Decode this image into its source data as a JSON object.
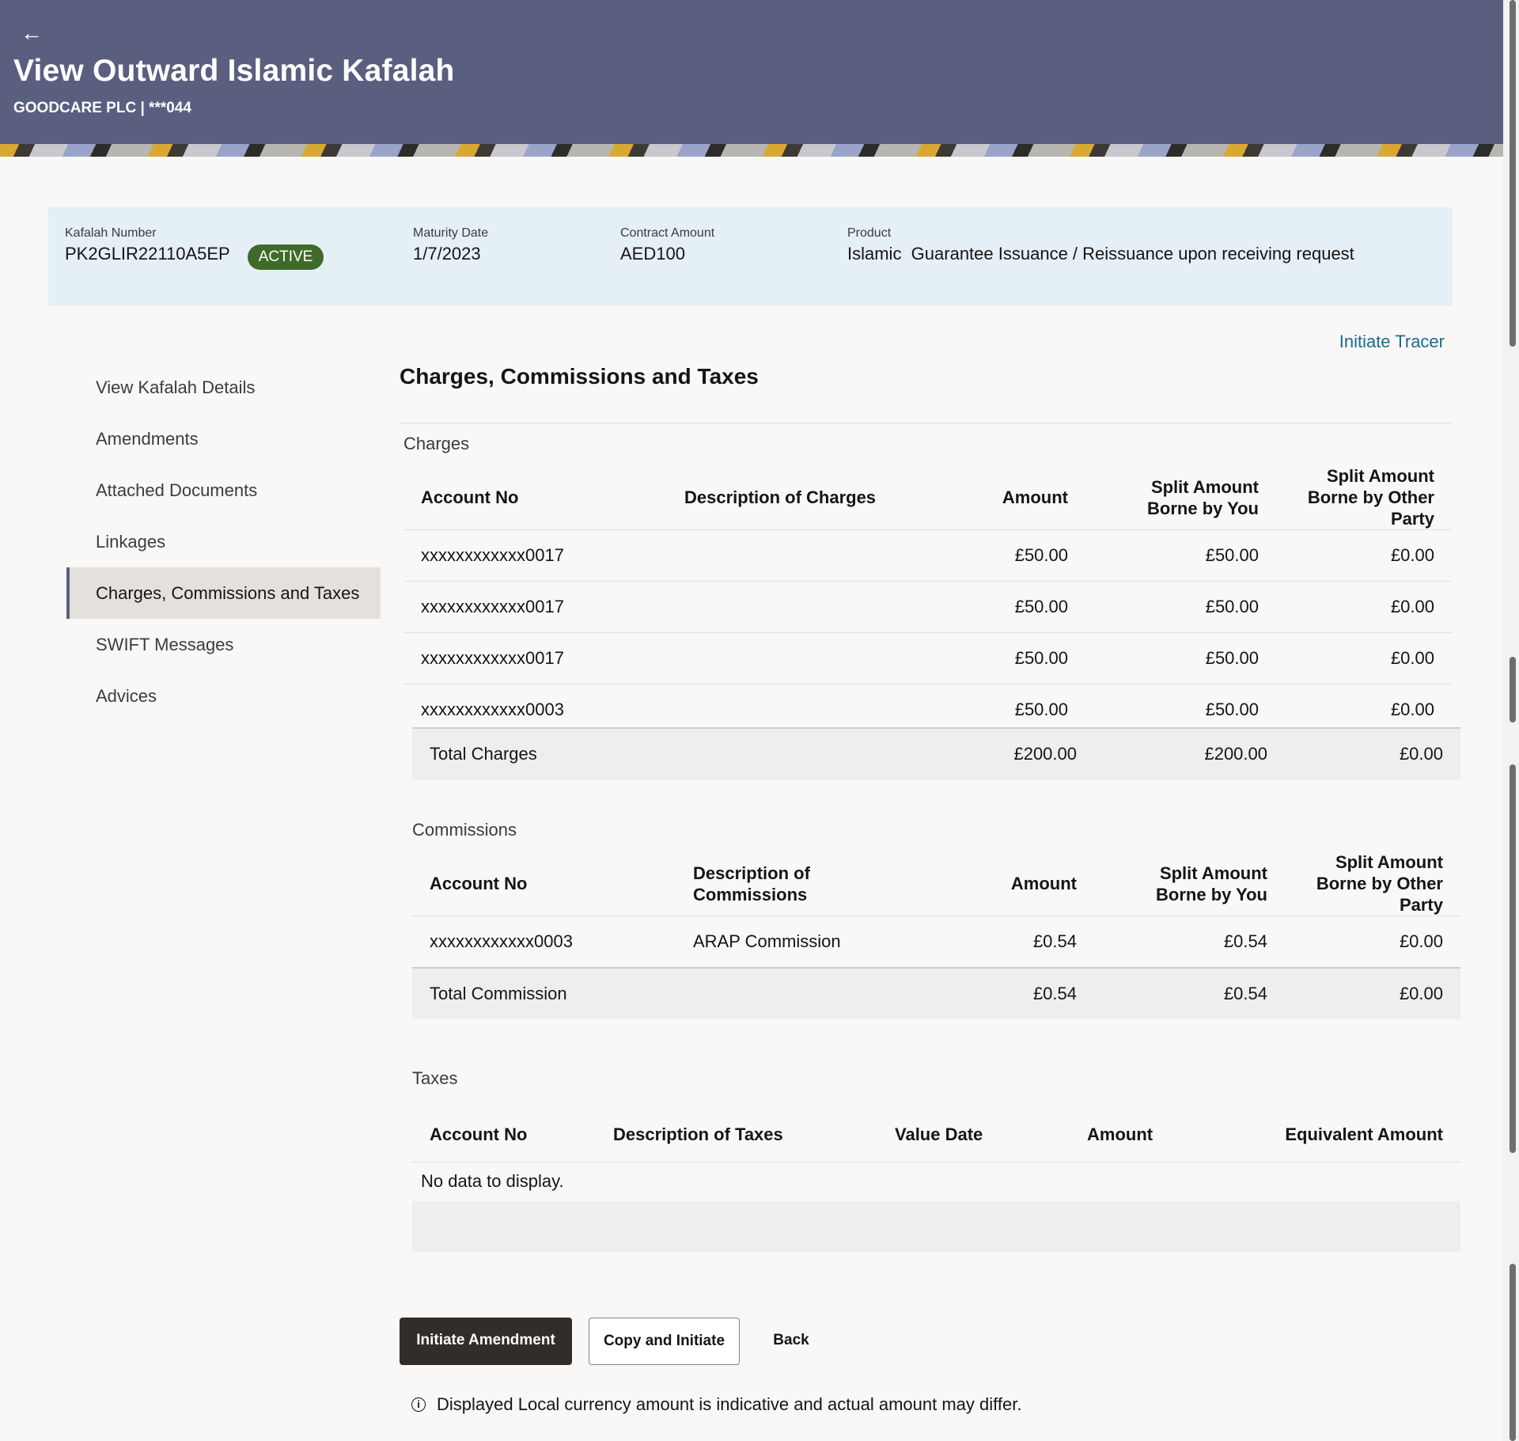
{
  "header": {
    "back_label": "←",
    "title": "View Outward Islamic Kafalah",
    "subtitle": "GOODCARE PLC | ***044"
  },
  "summary": {
    "kafalah_number_label": "Kafalah Number",
    "kafalah_number": "PK2GLIR22110A5EP",
    "status": "ACTIVE",
    "maturity_label": "Maturity Date",
    "maturity_date": "1/7/2023",
    "contract_amount_label": "Contract Amount",
    "contract_amount": "AED100",
    "product_label": "Product",
    "product": "Islamic  Guarantee Issuance / Reissuance upon receiving request",
    "status_color": "#3f6b2a"
  },
  "initiate_tracer": "Initiate Tracer",
  "nav": {
    "items": [
      {
        "label": "View Kafalah Details"
      },
      {
        "label": "Amendments"
      },
      {
        "label": "Attached Documents"
      },
      {
        "label": "Linkages"
      },
      {
        "label": "Charges, Commissions and Taxes"
      },
      {
        "label": "SWIFT Messages"
      },
      {
        "label": "Advices"
      }
    ]
  },
  "section_title": "Charges, Commissions and Taxes",
  "charges": {
    "label": "Charges",
    "headers": [
      "Account No",
      "Description of Charges",
      "Amount",
      "Split Amount Borne by You",
      "Split Amount Borne by Other Party"
    ],
    "rows": [
      [
        "xxxxxxxxxxxx0017",
        "",
        "£50.00",
        "£50.00",
        "£0.00"
      ],
      [
        "xxxxxxxxxxxx0017",
        "",
        "£50.00",
        "£50.00",
        "£0.00"
      ],
      [
        "xxxxxxxxxxxx0017",
        "",
        "£50.00",
        "£50.00",
        "£0.00"
      ],
      [
        "xxxxxxxxxxxx0003",
        "",
        "£50.00",
        "£50.00",
        "£0.00"
      ]
    ],
    "total": [
      "Total Charges",
      "£200.00",
      "£200.00",
      "£0.00"
    ]
  },
  "commissions": {
    "label": "Commissions",
    "headers": [
      "Account No",
      "Description of Commissions",
      "Amount",
      "Split Amount Borne by You",
      "Split Amount Borne by Other Party"
    ],
    "rows": [
      [
        "xxxxxxxxxxxx0003",
        "ARAP Commission",
        "£0.54",
        "£0.54",
        "£0.00"
      ]
    ],
    "total": [
      "Total Commission",
      "£0.54",
      "£0.54",
      "£0.00"
    ]
  },
  "taxes": {
    "label": "Taxes",
    "headers": [
      "Account No",
      "Description of Taxes",
      "Value Date",
      "Amount",
      "Equivalent Amount"
    ],
    "empty": "No data to display."
  },
  "buttons": {
    "initiate_amendment": "Initiate Amendment",
    "copy_and_initiate": "Copy and Initiate",
    "back": "Back"
  },
  "info_note": "Displayed Local currency amount is indicative and actual amount may differ.",
  "info_icon": "i"
}
